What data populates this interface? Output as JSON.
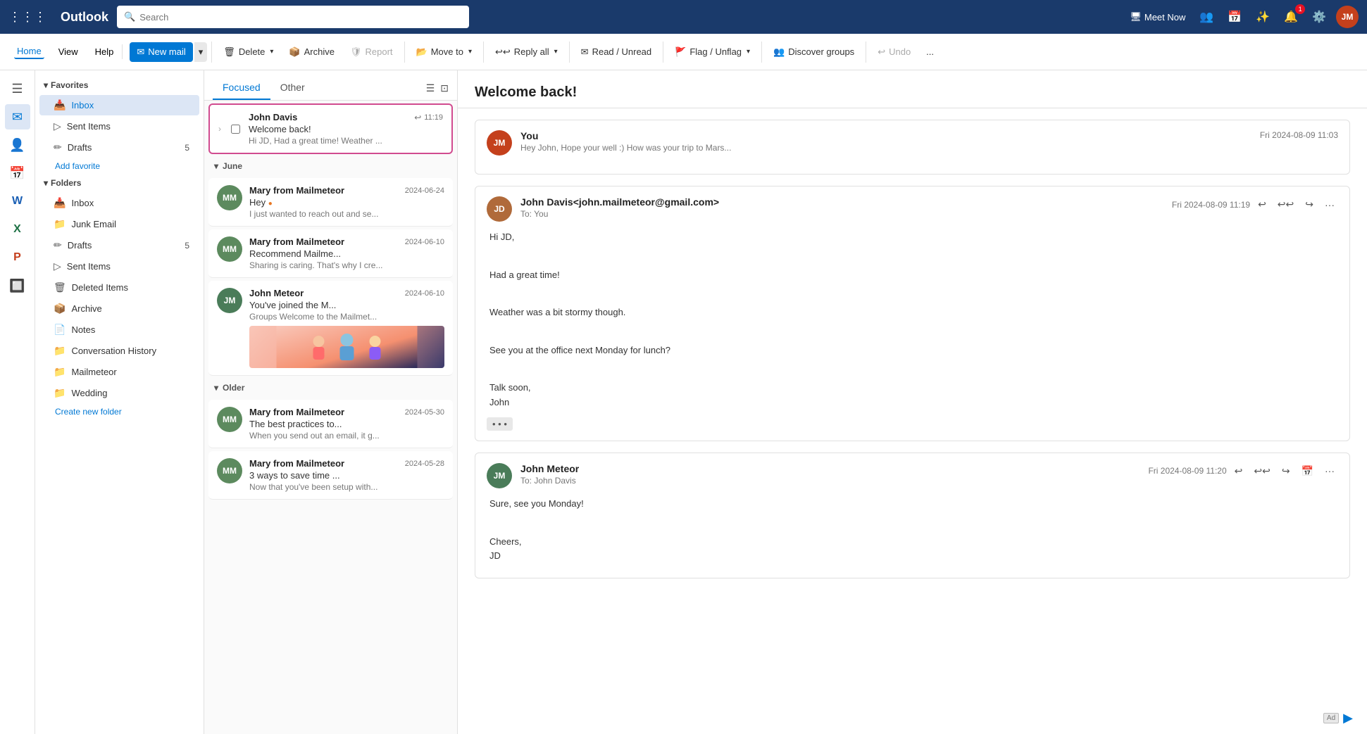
{
  "app": {
    "title": "Outlook",
    "logo": "Outlook"
  },
  "topbar": {
    "waffle": "⊞",
    "search_placeholder": "Search",
    "meet_now": "Meet Now",
    "avatar_initials": "JM",
    "notification_count": "1"
  },
  "ribbon": {
    "nav_items": [
      {
        "label": "Home",
        "active": true
      },
      {
        "label": "View",
        "active": false
      },
      {
        "label": "Help",
        "active": false
      }
    ],
    "new_mail_label": "New mail",
    "delete_label": "Delete",
    "archive_label": "Archive",
    "report_label": "Report",
    "move_to_label": "Move to",
    "reply_all_label": "Reply all",
    "read_unread_label": "Read / Unread",
    "flag_unflag_label": "Flag / Unflag",
    "discover_groups_label": "Discover groups",
    "undo_label": "Undo",
    "more_label": "..."
  },
  "sidebar": {
    "favorites_label": "Favorites",
    "folders_label": "Folders",
    "inbox_label": "Inbox",
    "sent_items_label": "Sent Items",
    "drafts_label": "Drafts",
    "drafts_count": "5",
    "add_favorite_label": "Add favorite",
    "folders_inbox_label": "Inbox",
    "junk_email_label": "Junk Email",
    "folders_drafts_label": "Drafts",
    "folders_drafts_count": "5",
    "folders_sent_label": "Sent Items",
    "deleted_items_label": "Deleted Items",
    "archive_label": "Archive",
    "notes_label": "Notes",
    "conversation_history_label": "Conversation History",
    "mailmeteor_label": "Mailmeteor",
    "wedding_label": "Wedding",
    "create_folder_label": "Create new folder"
  },
  "email_list": {
    "tabs": [
      {
        "label": "Focused",
        "active": true
      },
      {
        "label": "Other",
        "active": false
      }
    ],
    "selected_email": {
      "from": "John Davis",
      "subject": "Welcome back!",
      "preview": "Hi JD, Had a great time! Weather ...",
      "time": "11:19",
      "has_reply_icon": true
    },
    "sections": [
      {
        "label": "June",
        "emails": [
          {
            "from": "Mary from Mailmeteor",
            "subject": "Hey",
            "preview": "I just wanted to reach out and se...",
            "date": "2024-06-24",
            "avatar_initials": "MM",
            "avatar_color": "#5c8a5e",
            "has_dot": true
          },
          {
            "from": "Mary from Mailmeteor",
            "subject": "Recommend Mailme...",
            "preview": "Sharing is caring. That's why I cre...",
            "date": "2024-06-10",
            "avatar_initials": "MM",
            "avatar_color": "#5c8a5e",
            "has_dot": false
          },
          {
            "from": "John Meteor",
            "subject": "You've joined the M...",
            "preview": "Groups Welcome to the Mailmet...",
            "date": "2024-06-10",
            "avatar_initials": "JM",
            "avatar_color": "#4a7c59",
            "has_image": true
          }
        ]
      },
      {
        "label": "Older",
        "emails": [
          {
            "from": "Mary from Mailmeteor",
            "subject": "The best practices to...",
            "preview": "When you send out an email, it g...",
            "date": "2024-05-30",
            "avatar_initials": "MM",
            "avatar_color": "#5c8a5e",
            "has_dot": false
          },
          {
            "from": "Mary from Mailmeteor",
            "subject": "3 ways to save time ...",
            "preview": "Now that you've been setup with...",
            "date": "2024-05-28",
            "avatar_initials": "MM",
            "avatar_color": "#5c8a5e",
            "has_dot": false
          }
        ]
      }
    ]
  },
  "reading_pane": {
    "subject": "Welcome back!",
    "messages": [
      {
        "from": "You",
        "from_detail": "",
        "to": "",
        "date": "Fri 2024-08-09 11:03",
        "avatar_initials": "JM",
        "avatar_color": "#c4401c",
        "body_lines": [
          "Hey John, Hope your well :) How was your trip to Mars..."
        ],
        "has_expand": false
      },
      {
        "from": "John Davis",
        "from_detail": "<john.mailmeteor@gmail.com>",
        "to": "You",
        "date": "Fri 2024-08-09 11:19",
        "avatar_initials": "JD",
        "avatar_color": "#b06a3a",
        "body_lines": [
          "Hi JD,",
          "",
          "Had a great time!",
          "",
          "Weather was a bit stormy though.",
          "",
          "See you at the office next Monday for lunch?",
          "",
          "Talk soon,",
          "John"
        ],
        "has_expand": true
      },
      {
        "from": "John Meteor",
        "from_detail": "",
        "to": "John Davis",
        "date": "Fri 2024-08-09 11:20",
        "avatar_initials": "JM",
        "avatar_color": "#4a7c59",
        "body_lines": [
          "Sure, see you Monday!",
          "",
          "Cheers,",
          "JD"
        ],
        "has_expand": false
      }
    ]
  },
  "colors": {
    "brand_blue": "#1a3a6b",
    "accent_blue": "#0078d4",
    "pink_border": "#d14b8f"
  }
}
